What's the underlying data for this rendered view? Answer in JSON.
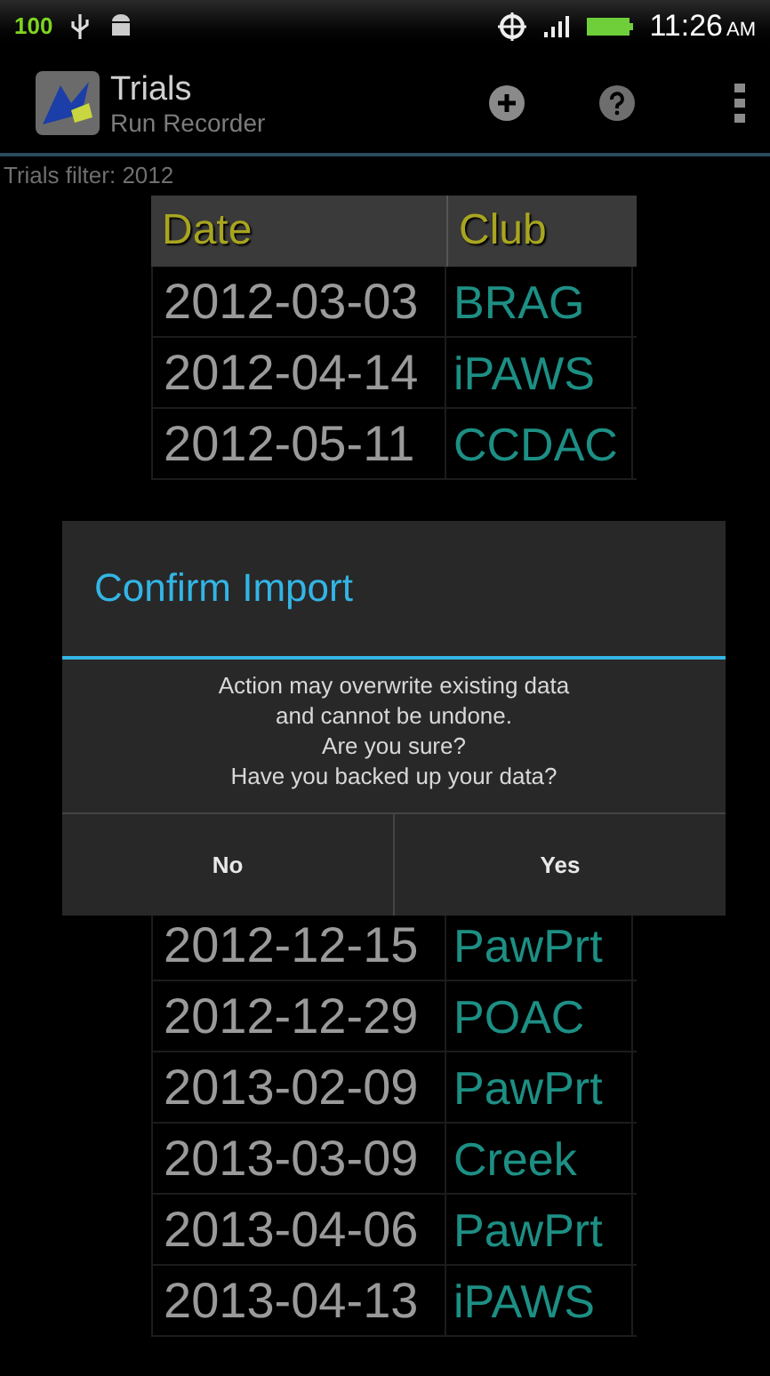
{
  "status_bar": {
    "badge": "100",
    "time": "11:26",
    "time_suffix": "AM"
  },
  "action_bar": {
    "title": "Trials",
    "subtitle": "Run Recorder"
  },
  "filter_label": "Trials filter: 2012",
  "table": {
    "columns": [
      "Date",
      "Club"
    ],
    "upper_rows": [
      {
        "date": "2012-03-03",
        "club": "BRAG"
      },
      {
        "date": "2012-04-14",
        "club": "iPAWS"
      },
      {
        "date": "2012-05-11",
        "club": "CCDAC"
      }
    ],
    "lower_rows": [
      {
        "date": "2012-12-15",
        "club": "PawPrt"
      },
      {
        "date": "2012-12-29",
        "club": "POAC"
      },
      {
        "date": "2013-02-09",
        "club": "PawPrt"
      },
      {
        "date": "2013-03-09",
        "club": "Creek"
      },
      {
        "date": "2013-04-06",
        "club": "PawPrt"
      },
      {
        "date": "2013-04-13",
        "club": "iPAWS"
      }
    ]
  },
  "dialog": {
    "title": "Confirm Import",
    "message_lines": [
      "Action may overwrite existing data",
      "and cannot be undone.",
      "Are you sure?",
      "Have you backed up your data?"
    ],
    "buttons": [
      "No",
      "Yes"
    ]
  }
}
